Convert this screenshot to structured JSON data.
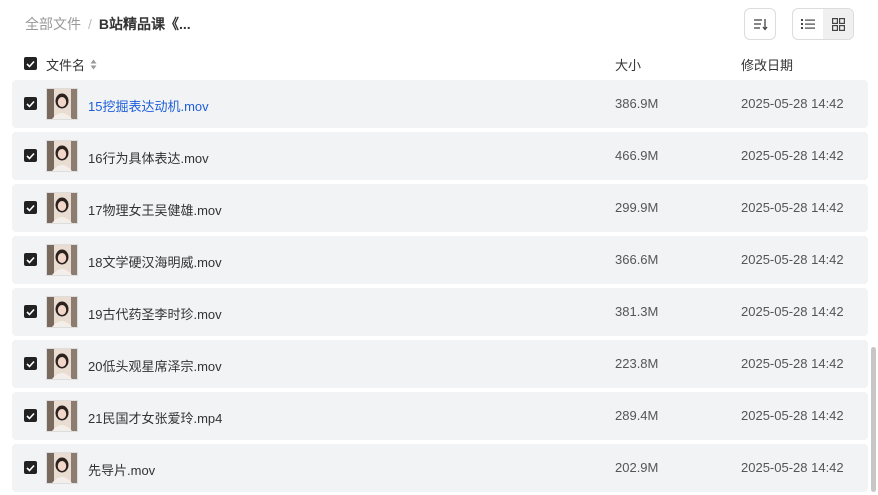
{
  "breadcrumb": {
    "root": "全部文件",
    "separator": "/",
    "current": "B站精品课《..."
  },
  "toolbar": {
    "sort_icon": "sort-order-icon",
    "list_view_icon": "list-view-icon",
    "grid_view_icon": "grid-view-icon",
    "active_view": "list"
  },
  "columns": {
    "name": "文件名",
    "size": "大小",
    "modified": "修改日期"
  },
  "files": [
    {
      "name": "15挖掘表达动机.mov",
      "size": "386.9M",
      "modified": "2025-05-28 14:42",
      "checked": true,
      "highlighted": true
    },
    {
      "name": "16行为具体表达.mov",
      "size": "466.9M",
      "modified": "2025-05-28 14:42",
      "checked": true
    },
    {
      "name": "17物理女王吴健雄.mov",
      "size": "299.9M",
      "modified": "2025-05-28 14:42",
      "checked": true
    },
    {
      "name": "18文学硬汉海明威.mov",
      "size": "366.6M",
      "modified": "2025-05-28 14:42",
      "checked": true
    },
    {
      "name": "19古代药圣李时珍.mov",
      "size": "381.3M",
      "modified": "2025-05-28 14:42",
      "checked": true
    },
    {
      "name": "20低头观星席泽宗.mov",
      "size": "223.8M",
      "modified": "2025-05-28 14:42",
      "checked": true
    },
    {
      "name": "21民国才女张爱玲.mp4",
      "size": "289.4M",
      "modified": "2025-05-28 14:42",
      "checked": true
    },
    {
      "name": "先导片.mov",
      "size": "202.9M",
      "modified": "2025-05-28 14:42",
      "checked": true
    }
  ],
  "colors": {
    "link": "#1e5fd8",
    "row_bg": "#f2f3f5",
    "checkbox": "#222222"
  }
}
